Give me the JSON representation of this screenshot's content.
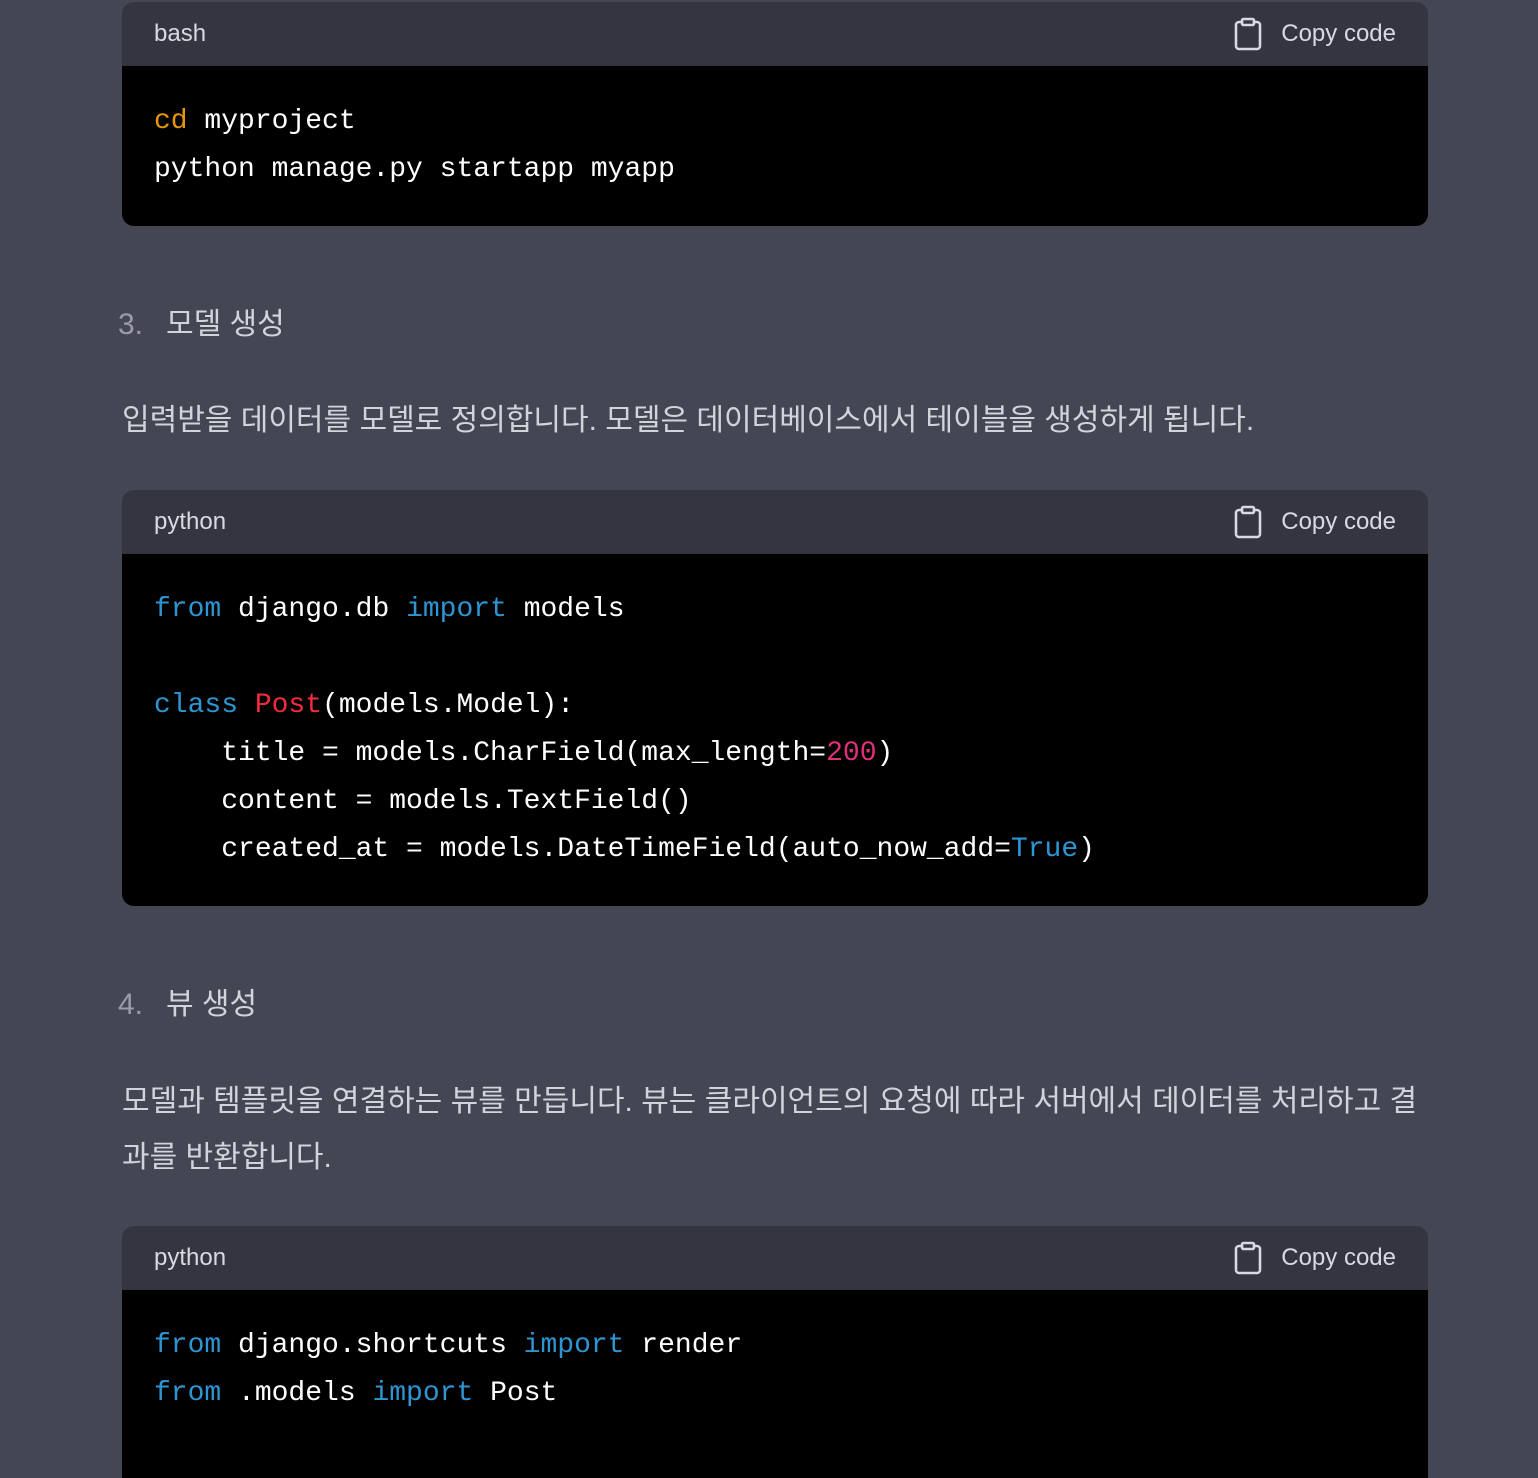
{
  "theme": {
    "page_background": "#444654",
    "code_header_background": "#343541",
    "code_background": "#000000",
    "header_text_color": "#d9d9e3",
    "text_color": "#d1d5db",
    "list_marker_color": "#9b9baa",
    "code_text_color": "#ffffff",
    "keyword_color": "#2e95d3",
    "builtin_color": "#e9950c",
    "class_name_color": "#f22c3d",
    "number_color": "#df3079"
  },
  "code_blocks": [
    {
      "language": "bash",
      "copy_label": "Copy code",
      "copy_icon": "clipboard-icon",
      "lines": [
        [
          "cd",
          " myproject"
        ],
        [
          "python manage.py startapp myapp"
        ]
      ]
    },
    {
      "language": "python",
      "copy_label": "Copy code",
      "copy_icon": "clipboard-icon",
      "lines": [
        [
          "from",
          " django.db ",
          "import",
          " models"
        ],
        [],
        [
          "class",
          " ",
          "Post",
          "(models.Model):"
        ],
        [
          "    title = models.CharField(max_length=",
          "200",
          ")"
        ],
        [
          "    content = models.TextField()"
        ],
        [
          "    created_at = models.DateTimeField(auto_now_add=",
          "True",
          ")"
        ]
      ]
    },
    {
      "language": "python",
      "copy_label": "Copy code",
      "copy_icon": "clipboard-icon",
      "lines": [
        [
          "from",
          " django.shortcuts ",
          "import",
          " render"
        ],
        [
          "from",
          " .models ",
          "import",
          " Post"
        ],
        []
      ]
    }
  ],
  "steps": [
    {
      "number": "3.",
      "title": "모델 생성",
      "description": "입력받을 데이터를 모델로 정의합니다. 모델은 데이터베이스에서 테이블을 생성하게 됩니다."
    },
    {
      "number": "4.",
      "title": "뷰 생성",
      "description": "모델과 템플릿을 연결하는 뷰를 만듭니다. 뷰는 클라이언트의 요청에 따라 서버에서 데이터를 처리하고 결과를 반환합니다."
    }
  ]
}
